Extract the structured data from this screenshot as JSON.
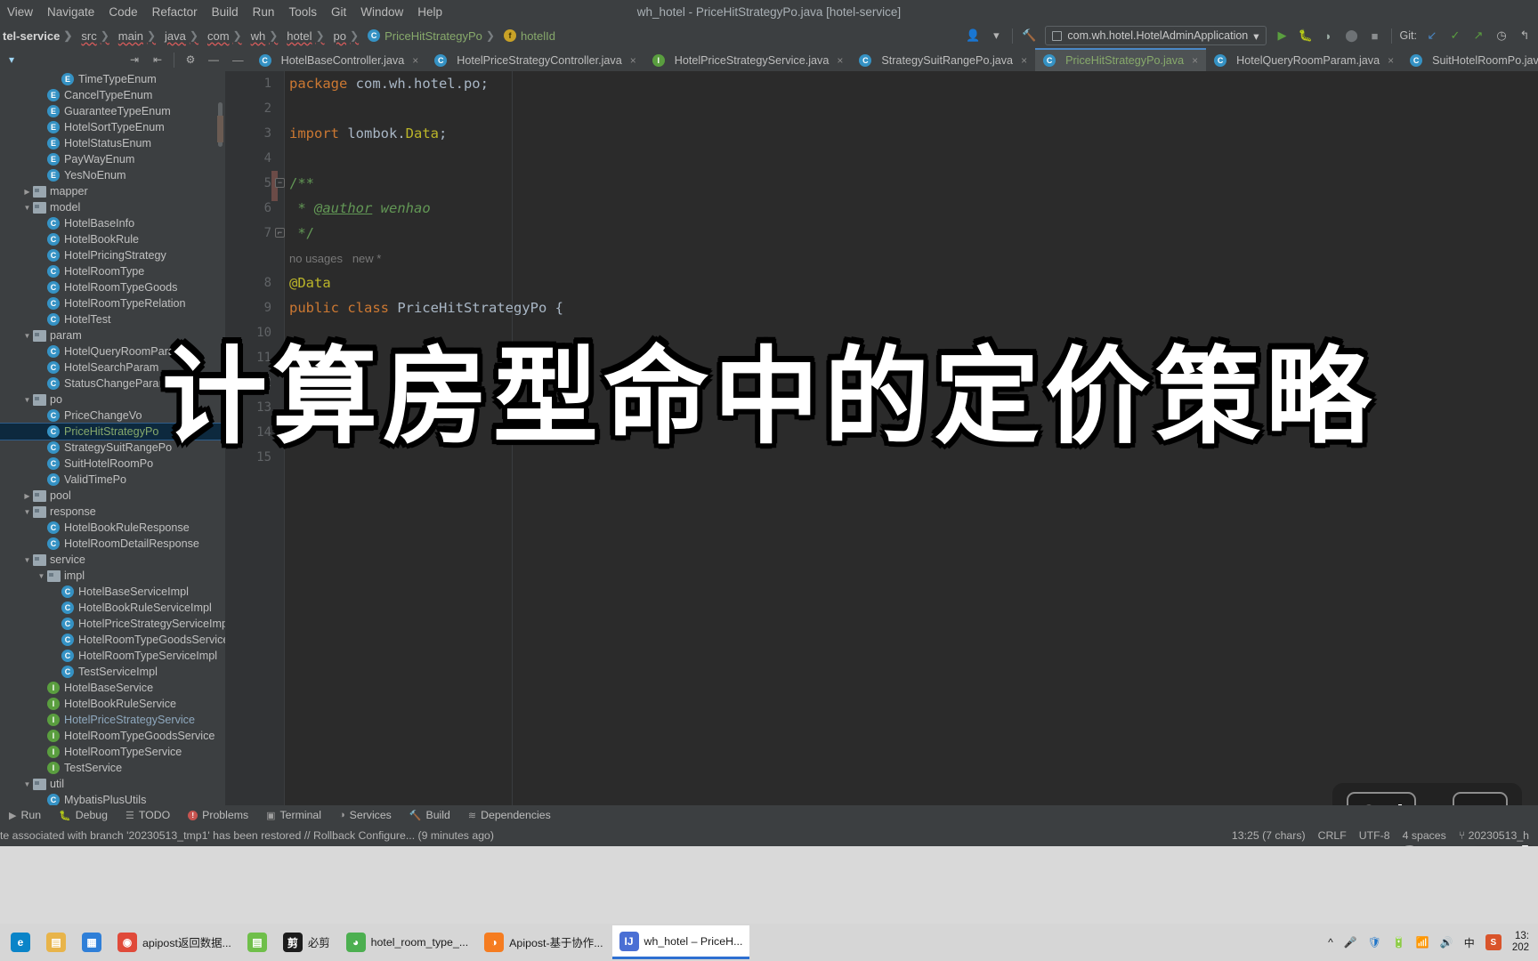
{
  "window": {
    "title": "wh_hotel - PriceHitStrategyPo.java [hotel-service]"
  },
  "menubar": {
    "items": [
      {
        "label": "View"
      },
      {
        "label": "Navigate"
      },
      {
        "label": "Code"
      },
      {
        "label": "Refactor"
      },
      {
        "label": "Build"
      },
      {
        "label": "Run"
      },
      {
        "label": "Tools"
      },
      {
        "label": "Git"
      },
      {
        "label": "Window"
      },
      {
        "label": "Help"
      }
    ]
  },
  "breadcrumb": {
    "items": [
      {
        "label": "tel-service",
        "kind": "module"
      },
      {
        "label": "src",
        "kind": "dir"
      },
      {
        "label": "main",
        "kind": "dir"
      },
      {
        "label": "java",
        "kind": "dir"
      },
      {
        "label": "com",
        "kind": "dir"
      },
      {
        "label": "wh",
        "kind": "dir"
      },
      {
        "label": "hotel",
        "kind": "dir"
      },
      {
        "label": "po",
        "kind": "dir"
      },
      {
        "label": "PriceHitStrategyPo",
        "kind": "class"
      },
      {
        "label": "hotelId",
        "kind": "field"
      }
    ]
  },
  "toolbar": {
    "run_configuration": "com.wh.hotel.HotelAdminApplication",
    "git_label": "Git:",
    "icons": [
      "user-avatar-icon",
      "chevron-down-icon",
      "build-hammer-icon",
      "run-icon",
      "debug-icon",
      "run-with-coverage-icon",
      "profile-icon",
      "stop-icon",
      "git-update-icon",
      "git-commit-icon",
      "git-push-icon",
      "history-icon",
      "rollback-icon"
    ]
  },
  "project_pane": {
    "header_icons": [
      "chevron-down-icon",
      "expand-all-icon",
      "collapse-all-icon",
      "settings-gear-icon",
      "hide-icon"
    ],
    "tree": [
      {
        "label": "TimeTypeEnum",
        "indent": 4,
        "kind": "enum",
        "arrow": ""
      },
      {
        "label": "CancelTypeEnum",
        "indent": 3,
        "kind": "enum",
        "arrow": ""
      },
      {
        "label": "GuaranteeTypeEnum",
        "indent": 3,
        "kind": "enum",
        "arrow": ""
      },
      {
        "label": "HotelSortTypeEnum",
        "indent": 3,
        "kind": "enum",
        "arrow": ""
      },
      {
        "label": "HotelStatusEnum",
        "indent": 3,
        "kind": "enum",
        "arrow": ""
      },
      {
        "label": "PayWayEnum",
        "indent": 3,
        "kind": "enum",
        "arrow": ""
      },
      {
        "label": "YesNoEnum",
        "indent": 3,
        "kind": "enum",
        "arrow": ""
      },
      {
        "label": "mapper",
        "indent": 2,
        "kind": "folder",
        "arrow": "collapsed"
      },
      {
        "label": "model",
        "indent": 2,
        "kind": "folder",
        "arrow": "expanded"
      },
      {
        "label": "HotelBaseInfo",
        "indent": 3,
        "kind": "class",
        "arrow": ""
      },
      {
        "label": "HotelBookRule",
        "indent": 3,
        "kind": "class",
        "arrow": ""
      },
      {
        "label": "HotelPricingStrategy",
        "indent": 3,
        "kind": "class",
        "arrow": ""
      },
      {
        "label": "HotelRoomType",
        "indent": 3,
        "kind": "class",
        "arrow": ""
      },
      {
        "label": "HotelRoomTypeGoods",
        "indent": 3,
        "kind": "class",
        "arrow": ""
      },
      {
        "label": "HotelRoomTypeRelation",
        "indent": 3,
        "kind": "class",
        "arrow": ""
      },
      {
        "label": "HotelTest",
        "indent": 3,
        "kind": "class",
        "arrow": ""
      },
      {
        "label": "param",
        "indent": 2,
        "kind": "folder",
        "arrow": "expanded"
      },
      {
        "label": "HotelQueryRoomParam",
        "indent": 3,
        "kind": "class",
        "arrow": ""
      },
      {
        "label": "HotelSearchParam",
        "indent": 3,
        "kind": "class",
        "arrow": ""
      },
      {
        "label": "StatusChangeParam",
        "indent": 3,
        "kind": "class",
        "arrow": ""
      },
      {
        "label": "po",
        "indent": 2,
        "kind": "folder",
        "arrow": "expanded"
      },
      {
        "label": "PriceChangeVo",
        "indent": 3,
        "kind": "class",
        "arrow": ""
      },
      {
        "label": "PriceHitStrategyPo",
        "indent": 3,
        "kind": "class",
        "arrow": "",
        "selected": true,
        "color": "green"
      },
      {
        "label": "StrategySuitRangePo",
        "indent": 3,
        "kind": "class",
        "arrow": ""
      },
      {
        "label": "SuitHotelRoomPo",
        "indent": 3,
        "kind": "class",
        "arrow": ""
      },
      {
        "label": "ValidTimePo",
        "indent": 3,
        "kind": "class",
        "arrow": ""
      },
      {
        "label": "pool",
        "indent": 2,
        "kind": "folder",
        "arrow": "collapsed"
      },
      {
        "label": "response",
        "indent": 2,
        "kind": "folder",
        "arrow": "expanded"
      },
      {
        "label": "HotelBookRuleResponse",
        "indent": 3,
        "kind": "class",
        "arrow": ""
      },
      {
        "label": "HotelRoomDetailResponse",
        "indent": 3,
        "kind": "class",
        "arrow": ""
      },
      {
        "label": "service",
        "indent": 2,
        "kind": "folder",
        "arrow": "expanded"
      },
      {
        "label": "impl",
        "indent": 3,
        "kind": "folder",
        "arrow": "expanded"
      },
      {
        "label": "HotelBaseServiceImpl",
        "indent": 4,
        "kind": "class",
        "arrow": ""
      },
      {
        "label": "HotelBookRuleServiceImpl",
        "indent": 4,
        "kind": "class",
        "arrow": ""
      },
      {
        "label": "HotelPriceStrategyServiceImpl",
        "indent": 4,
        "kind": "class",
        "arrow": ""
      },
      {
        "label": "HotelRoomTypeGoodsServiceImpl",
        "indent": 4,
        "kind": "class",
        "arrow": ""
      },
      {
        "label": "HotelRoomTypeServiceImpl",
        "indent": 4,
        "kind": "class",
        "arrow": ""
      },
      {
        "label": "TestServiceImpl",
        "indent": 4,
        "kind": "class",
        "arrow": ""
      },
      {
        "label": "HotelBaseService",
        "indent": 3,
        "kind": "interface",
        "arrow": ""
      },
      {
        "label": "HotelBookRuleService",
        "indent": 3,
        "kind": "interface",
        "arrow": ""
      },
      {
        "label": "HotelPriceStrategyService",
        "indent": 3,
        "kind": "interface",
        "arrow": "",
        "color": "blueish"
      },
      {
        "label": "HotelRoomTypeGoodsService",
        "indent": 3,
        "kind": "interface",
        "arrow": ""
      },
      {
        "label": "HotelRoomTypeService",
        "indent": 3,
        "kind": "interface",
        "arrow": ""
      },
      {
        "label": "TestService",
        "indent": 3,
        "kind": "interface",
        "arrow": ""
      },
      {
        "label": "util",
        "indent": 2,
        "kind": "folder",
        "arrow": "expanded"
      },
      {
        "label": "MybatisPlusUtils",
        "indent": 3,
        "kind": "class",
        "arrow": ""
      }
    ]
  },
  "editor_tabs": [
    {
      "label": "HotelBaseController.java",
      "kind": "class",
      "active": false
    },
    {
      "label": "HotelPriceStrategyController.java",
      "kind": "class",
      "active": false
    },
    {
      "label": "HotelPriceStrategyService.java",
      "kind": "interface",
      "active": false
    },
    {
      "label": "StrategySuitRangePo.java",
      "kind": "class",
      "active": false
    },
    {
      "label": "PriceHitStrategyPo.java",
      "kind": "class",
      "active": true
    },
    {
      "label": "HotelQueryRoomParam.java",
      "kind": "class",
      "active": false
    },
    {
      "label": "SuitHotelRoomPo.java",
      "kind": "class",
      "active": false
    }
  ],
  "code": {
    "lines": [
      {
        "num": "1",
        "segments": [
          {
            "t": "package",
            "c": "kw"
          },
          {
            "t": " com.wh.hotel.po;",
            "c": "plain"
          }
        ]
      },
      {
        "num": "2",
        "segments": []
      },
      {
        "num": "3",
        "segments": [
          {
            "t": "import",
            "c": "kw"
          },
          {
            "t": " lombok.",
            "c": "plain"
          },
          {
            "t": "Data",
            "c": "anno"
          },
          {
            "t": ";",
            "c": "plain"
          }
        ]
      },
      {
        "num": "4",
        "segments": []
      },
      {
        "num": "5",
        "segments": [
          {
            "t": "/**",
            "c": "cmt"
          }
        ],
        "fold": "minus"
      },
      {
        "num": "6",
        "segments": [
          {
            "t": " * ",
            "c": "cmt"
          },
          {
            "t": "@author",
            "c": "cmt-link"
          },
          {
            "t": " wenhao",
            "c": "cmt-i"
          }
        ]
      },
      {
        "num": "7",
        "segments": [
          {
            "t": " */",
            "c": "cmt"
          }
        ],
        "fold": "end"
      },
      {
        "num": "",
        "segments": [
          {
            "t": "no usages   new *",
            "c": "hint"
          }
        ]
      },
      {
        "num": "8",
        "segments": [
          {
            "t": "@Data",
            "c": "anno"
          }
        ]
      },
      {
        "num": "9",
        "segments": [
          {
            "t": "public class",
            "c": "kw"
          },
          {
            "t": " PriceHitStrategyPo {",
            "c": "plain"
          }
        ]
      },
      {
        "num": "10",
        "segments": []
      },
      {
        "num": "11",
        "segments": []
      },
      {
        "num": "12",
        "segments": []
      },
      {
        "num": "13",
        "segments": []
      },
      {
        "num": "14",
        "segments": [
          {
            "t": "}",
            "c": "plain"
          }
        ]
      },
      {
        "num": "15",
        "segments": []
      }
    ]
  },
  "overlay": {
    "big_title": "计算房型命中的定价策略",
    "keycap_primary": "Ctrl",
    "keycap_plus": "+",
    "keycap_secondary": "D",
    "watermark": "ro x 2 mTyi"
  },
  "bottom_toolwindows": [
    {
      "label": "Run",
      "icon": "run-icon"
    },
    {
      "label": "Debug",
      "icon": "debug-icon"
    },
    {
      "label": "TODO",
      "icon": "todo-icon"
    },
    {
      "label": "Problems",
      "icon": "problems-icon"
    },
    {
      "label": "Terminal",
      "icon": "terminal-icon"
    },
    {
      "label": "Services",
      "icon": "services-icon"
    },
    {
      "label": "Build",
      "icon": "build-hammer-icon"
    },
    {
      "label": "Dependencies",
      "icon": "dependencies-icon"
    }
  ],
  "statusbar": {
    "message": "te associated with branch '20230513_tmp1' has been restored // Rollback   Configure... (9 minutes ago)",
    "caret_position": "13:25 (7 chars)",
    "line_separator": "CRLF",
    "encoding": "UTF-8",
    "indent": "4 spaces",
    "branch": "20230513_h"
  },
  "taskbar": {
    "items": [
      {
        "label": "",
        "icon": "edge-icon",
        "color": "#0a84c8",
        "glyph": "e",
        "active": false
      },
      {
        "label": "",
        "icon": "file-explorer-icon",
        "color": "#e8b44a",
        "glyph": "▤",
        "active": false
      },
      {
        "label": "",
        "icon": "store-icon",
        "color": "#2f7fd8",
        "glyph": "▦",
        "active": false
      },
      {
        "label": "apipost返回数据...",
        "icon": "chrome-icon",
        "color": "#e04a3a",
        "glyph": "◉",
        "active": false
      },
      {
        "label": "",
        "icon": "notepad-icon",
        "color": "#6fbf4a",
        "glyph": "▤",
        "active": false
      },
      {
        "label": "必剪",
        "icon": "bijian-icon",
        "color": "#1c1c1c",
        "glyph": "剪",
        "active": false
      },
      {
        "label": "hotel_room_type_...",
        "icon": "navicat-icon",
        "color": "#4caf50",
        "glyph": "◕",
        "active": false
      },
      {
        "label": "Apipost-基于协作...",
        "icon": "apipost-icon",
        "color": "#f57c20",
        "glyph": "◑",
        "active": false
      },
      {
        "label": "wh_hotel – PriceH...",
        "icon": "intellij-icon",
        "color": "#4a6fd4",
        "glyph": "IJ",
        "active": true
      }
    ],
    "tray_icons": [
      "show-hidden-icon",
      "mic-icon",
      "security-icon",
      "battery-icon",
      "wifi-icon",
      "volume-icon",
      "ime-icon",
      "sogou-icon"
    ],
    "clock_time": "13:",
    "clock_date": "202"
  },
  "colors": {
    "accent_blue": "#4a88c7",
    "selection": "#0d293e",
    "editor_bg": "#2b2b2b",
    "chrome_bg": "#3c3f41",
    "green_text": "#87a96b",
    "keyword_orange": "#cc7832",
    "annotation_yellow": "#bbb529",
    "comment_green": "#629755"
  }
}
